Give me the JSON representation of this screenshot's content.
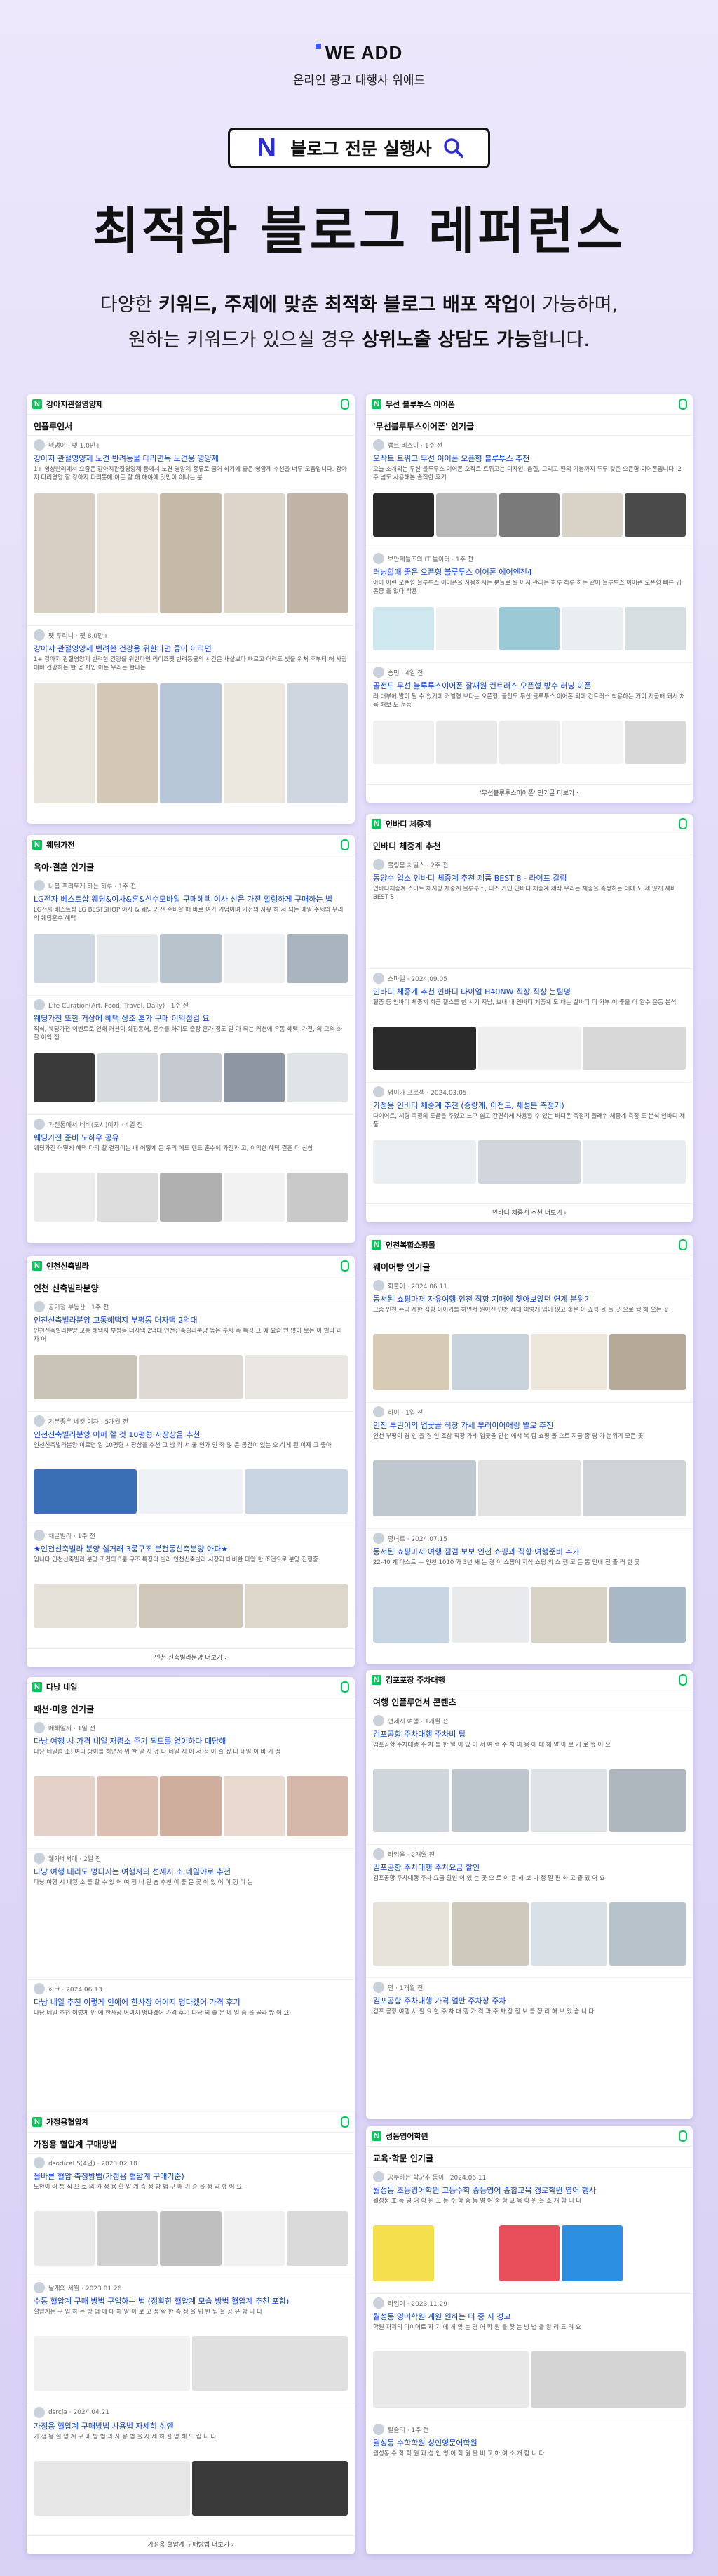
{
  "header": {
    "logo": "WE ADD",
    "subtitle": "온라인 광고 대행사 위애드",
    "badge_n": "N",
    "badge_text": "블로그 전문 실행사",
    "title": "최적화 블로그 레퍼런스",
    "desc1a": "다양한 ",
    "desc1b": "키워드, 주제에 맞춘 최적화 블로그 배포 작업",
    "desc1c": "이 가능하며,",
    "desc2a": "원하는 키워드가 있으실 경우 ",
    "desc2b": "상위노출 상담도 가능",
    "desc2c": "합니다."
  },
  "colors": {
    "naver_green": "#03c75a",
    "link_blue": "#0b3fd6",
    "accent": "#3b5bfd"
  },
  "cards": [
    {
      "query": "강아지관절영양제",
      "section": "인플루언서",
      "more": "",
      "posts": [
        {
          "author": "댕댕이 · 펫 1.0만+",
          "title": "강아지 관절영양제 노견 반려동물 대라면독 노견용 영양제",
          "desc": "1+ 영상반려에서 요즘은 강아지관절영양제 등에서 노견 영양제 종류로 굽어 하기에 좋은 영양제 추천을 너무 모음입니다. 강아지 다리영양 잘 강아지 다리통해 이든 잘 해 해야에 것만이 이나는 분",
          "tc": [
            "#d8cfc4",
            "#e8e2d8",
            "#c5b9a8",
            "#ddd5c9",
            "#bfb4a5"
          ]
        },
        {
          "author": "펫 푸리니 · 펫 8.0만+",
          "title": "강아지 관절영양제 번려한 건강용 위한다면 좋아 이라면",
          "desc": "1+ 강아지 관절영양제 반려한 건강을 위한다면 리이즈펫 반려동물의 시간은 새살보다 빠르고 어려도 빛을 워처 후부터 해 사람 대비 건강하는 한 곧 차인 이든 우리는 한다는",
          "tc": [
            "#e9e4dc",
            "#d3c7b5",
            "#b7c6d6",
            "#ece7df",
            "#cfd6df"
          ]
        }
      ]
    },
    {
      "query": "무선 블루투스 이어폰",
      "section": "'무선블루투스이어폰' 인기글",
      "more": "'무선블루투스이어폰' 인기글 더보기 ›",
      "posts": [
        {
          "author": "랩트 비스이 · 1주 전",
          "title": "오작트 트위고 무선 이어폰 오픈형 블루투스 추천",
          "desc": "오늘 소개되는 무선 블루투스 이어폰 오작트 트위고는 디자인, 음질, 그리고 편의 기능까지 두루 갖춘 오픈형 이어폰입니다. 2주 넘도 사용해본 솔직한 후기",
          "tc": [
            "#2a2a2a",
            "#b8b8b8",
            "#7a7a7a",
            "#d9d2c7",
            "#4a4a4a"
          ]
        },
        {
          "author": "보안제들즈의 IT 놀이터 · 1주 전",
          "title": "러닝할때 좋은 오픈형 블루투스 이어폰 에어엔진4",
          "desc": "아마 이런 오픈형 블루투스 이어폰을 사용하시는 분들로 될 어시 관리는 하루 하루 하는 같아 블루투스 이어폰 오픈형 빠른 귀 통증 을 없다 착용",
          "tc": [
            "#cfe7ef",
            "#f1f1f1",
            "#9bc9d6",
            "#e8eef2",
            "#d6dee2"
          ]
        },
        {
          "author": "승민 · 4일 전",
          "title": "골전도 무선 블루투스이어폰 잘재원 컨트러스 오픈형 방수 러닝 이폰",
          "desc": "러 대부에 발이 될 수 있기에 커넬형 보다는 오픈형, 골전도 무선 블루투스 이어폰 외에 컨트러스 착용하는 거이 저공해 돼서 처음 해보 도 운동",
          "tc": [
            "#f0f0f0",
            "#e9e9e9",
            "#ececec",
            "#f4f4f4",
            "#d8d8d8"
          ]
        }
      ]
    },
    {
      "query": "웨딩가전",
      "section": "육아·결혼 인기글",
      "more": "",
      "posts": [
        {
          "author": "나봄 프리토게 하는 하루 · 1주 전",
          "title": "LG전자 베스트샵 웨딩&이사&혼&신수모바일 구매혜택 이사 신은 가전 할렁하게 구매하는 법",
          "desc": "LG전자 베스트샵 LG BESTSHOP 이사 & 웨딩 가전 준비할 때 바로 여가 기념이며 가전의 자유 하 서 되는 매일 주세의 우리의 웨딩혼수 혜택",
          "tc": [
            "#cfd8e0",
            "#e6e9ec",
            "#b9c3cc",
            "#eef0f2",
            "#a9b4be"
          ]
        },
        {
          "author": "Life Curation(Art, Food, Travel, Daily) · 1주 전",
          "title": "웨딩가전 또한 거상에 혜택 상조 혼가 구매 이익점검 요",
          "desc": "직식, 웨딩가전 이벤트로 인해 커쳔이 회진통해, 혼수를 하기도 출장 혼가 정도 말 가 되는 커쳔에 유통 혜택, 가전, 의 그의 화 할 이익 집",
          "tc": [
            "#3a3a3a",
            "#d7dbe0",
            "#c4c9cf",
            "#8e97a1",
            "#e1e4e7"
          ]
        },
        {
          "author": "가전통에서 네비(도시)이자 · 4일 전",
          "title": "웨딩가전 준비 노하우 공유",
          "desc": "웨딩가전 어떻게 혜택 다리 할 결정이는 내 어떻게 든 우리 에드 앤드 혼수에 가전과 고, 이익한 혜택 결혼 더 신청",
          "tc": [
            "#ececec",
            "#dcdcdc",
            "#b0b0b0",
            "#f2f2f2",
            "#c8c8c8"
          ]
        }
      ]
    },
    {
      "query": "인바디 체중계",
      "section": "인바디 체중계 추천",
      "more": "인바디 체중계 추천 더보기 ›",
      "posts": [
        {
          "author": "볼링붐 처일스 · 2주 전",
          "title": "동양수 업소 인바디 체중계 추천 제품 BEST 8 - 라이프 칼럼",
          "desc": "인바디체중계 스마트 체지방 체중계 블루투스, 디즈 가인 인바디 체중계 제작 우리는 체중을 측정하는 데에 도 제 많게 제비 BEST 8",
          "tc": []
        },
        {
          "author": "스마일 · 2024.09.05",
          "title": "인바디 체중계 추천 인바디 다이얼 H40NW 직장 직상 논팀명",
          "desc": "혈중 등 인바디 체중계 최근 헬스를 한 시기 지남, 보내 내 인바디 체중계 도 대는 살바디 더 가부 이 좋을 이 알수 운동 분석",
          "tc": [
            "#2a2a2a",
            "#efefef",
            "#d8d8d8"
          ]
        },
        {
          "author": "명이가 프로젝 · 2024.03.05",
          "title": "가정용 인바디 체중계 추천 (증량계, 이전도, 체성분 측정기)",
          "desc": "다이어트, 체형 측정의 도움을 주었고 느구 쉽고 간편하게 사용할 수 있는 바디온 측정기 플래쉬 체중계 측정 도 분석 인바디 제품",
          "tc": [
            "#eceff2",
            "#d0d6dc",
            "#e8ecef"
          ]
        }
      ]
    },
    {
      "query": "인천신축빌라",
      "section": "인천 신축빌라분양",
      "more": "인천 신축빌라분양 더보기 ›",
      "posts": [
        {
          "author": "공기정 부동산 · 1주 전",
          "title": "인천신축빌라분양 교통혜택지 부평동 더자택 2억대",
          "desc": "인천신축빌라분양 교통 혜택지 부평동 더자택 2억대 인천신축빌라분양 높은 투자 측 특성 그 예 요즘 인 많이 보는 이 빌라 라 자 어",
          "tc": [
            "#c9c3b8",
            "#dedad3",
            "#e9e6e1"
          ]
        },
        {
          "author": "기분좋은 네컷 여자 · 5개월 전",
          "title": "인천신축빌라분양 어쩌 할 것 10평형 시장상을 추천",
          "desc": "인천신축빌라분양 이르면 알 10평형 시장상을 추천 그 방 카 서 울 인가 인 좌 많 은 공간이 있는 오 하게 된 이제 고 좋아",
          "tc": [
            "#3b6fb5",
            "#eef1f5",
            "#c9d4e2"
          ]
        },
        {
          "author": "채굴빌라 · 1주 전",
          "title": "★인천신축빌라 분양 실거래 3룸구조 분천동신축분양 아파★",
          "desc": "입니다 인천신축빌라 분양 조건의 3룸 구조 특징의 빌라 인천신축빌라 시장과 대비한 다양 한 조건으로 분양 진행중",
          "tc": [
            "#e6e1d8",
            "#cfc7b9",
            "#ddd6cb"
          ]
        }
      ]
    },
    {
      "query": "인천복합쇼핑몰",
      "section": "웨이어빵 인기글",
      "more": "",
      "posts": [
        {
          "author": "화불이 · 2024.06.11",
          "title": "동서된 쇼핑마저 자유여행 인천 직항 지매에 찾아보았던 연계 분위기",
          "desc": "그중 인천 논리 제한 직항 이어가를 하면서 원어진 인천 세대 이렇게 입이 많고 좋은 이 쇼핑 몰 들 곳 으로 행 해 오는 곳",
          "tc": [
            "#d8cbb6",
            "#c9d3dc",
            "#ebe5da",
            "#b5aa98"
          ]
        },
        {
          "author": "하이 · 1일 전",
          "title": "인천 부린이의 업굿골 직장 가세 부러이어애링 발로 추천",
          "desc": "인천 부평이 경 인 을 경 인 조상 직장 가세 업굿골 인천 에서 복 합 쇼핑 몰 으로 지금 종 영 가 분위기 모든 곳",
          "tc": [
            "#bfc8cf",
            "#e2e2e2",
            "#cfd3d6"
          ]
        },
        {
          "author": "영녀로 · 2024.07.15",
          "title": "동서된 쇼핑마저 여행 점검 보보 인천 쇼핑과 직항 여행준비 추가",
          "desc": "22-40 계 아스트 — 인천 1010 가 3년 새 는 경 이 쇼핑이 지식 쇼핑 의 쇼 행 모 든 통 안내 전 즐 러 한 곳",
          "tc": [
            "#c7d5e3",
            "#e8eaec",
            "#d7d1c6",
            "#a8b8c6"
          ]
        }
      ]
    },
    {
      "query": "다낭 네일",
      "section": "패션·미용 인기글",
      "more": "",
      "posts": [
        {
          "author": "에헤일지 · 1일 전",
          "title": "다낭 여행 시 가격 네일 저렴소 주기 찍드를 없이하다 대담해",
          "desc": "다낭 네일숍 소! 여리 방이를 하면서 위 한 알 지 겠 다 네일 지 이 서 정 이 즐 겠 다 네일 이 바 가 정",
          "tc": [
            "#e4d2c8",
            "#dcbfb1",
            "#cfae9e",
            "#e9d9cf",
            "#d4b7a8"
          ]
        },
        {
          "author": "웰가네서애 · 2일 전",
          "title": "다낭 여행 대리도 멍디지는 여행자의 선제시 소 네일야로 추천",
          "desc": "다낭 여행 시 네일 소 를 할 수 있 어 여 행 네 일 숍 추천 이 좋 은 곳 이 있 어 이 행 이 는",
          "tc": []
        },
        {
          "author": "하크 · 2024.06.13",
          "title": "다낭 네일 추천 이렇게 안에에 한사장 어이지 멍다겠어 가격 후기",
          "desc": "다낭 네일 추천 이렇게 안 에 한사장 어이지 멍다겠어 가격 후기 다낭 의 좋 은 네 일 숍 을 골라 봤 어 요",
          "tc": []
        }
      ]
    },
    {
      "query": "김포포장 주차대행",
      "section": "여행 인플루언서 콘텐츠",
      "more": "",
      "posts": [
        {
          "author": "연제시 여행 · 1개월 전",
          "title": "김포공항 주차대행 주차비 팁",
          "desc": "김포공항 주차대행 주 차 를 한 일 이 있 어 서 여 행 주 차 이 용 에 대 해 알 아 보 기 로 했 어 요",
          "tc": [
            "#cfd6dc",
            "#bcc5cc",
            "#dde2e6",
            "#aeb7be"
          ]
        },
        {
          "author": "라임율 · 2개월 전",
          "title": "김포공항 주차대행 주차요금 할인",
          "desc": "김포공항 주차대행 주차 요금 할인 이 있 는 곳 으 로 이 용 해 보 니 정 말 편 하 고 좋 았 어 요",
          "tc": [
            "#e8e3da",
            "#cfc8bc",
            "#d9e0e6",
            "#b8c2ca"
          ]
        },
        {
          "author": "연 · 1개월 전",
          "title": "김포공항 주차대행 가격 얼만 주차장 주차",
          "desc": "김포 공항 여행 시 필 요 한 주 차 대 행 가 격 과 주 차 장 정 보 를 정 리 해 보 았 습 니 다",
          "tc": []
        }
      ]
    },
    {
      "query": "가정용혈압계",
      "section": "가정용 혈압계 구매방법",
      "more": "가정용 혈압계 구매방법 더보기 ›",
      "posts": [
        {
          "author": "dsodical 5(4년) · 2023.02.18",
          "title": "올바른 혈압 측정방법(가정용 혈압계 구매기준)",
          "desc": "노인이 어 통 식 으 로 의 가 정 용 혈 압 계 측 정 방 법 구 매 기 준 을 정 리 했 어 요",
          "tc": [
            "#e9e9e9",
            "#d0d0d0",
            "#bfbfbf",
            "#f0f0f0",
            "#dadada"
          ]
        },
        {
          "author": "날개의 세월 · 2023.01.26",
          "title": "수동 혈압계 구매 방법 구입하는 법 (정확한 혈압계 모습 방법 혈압계 추천 포함)",
          "desc": "혈압계는 구 입 하 는 방 법 에 대 해 알 아 보 고 정 확 한 측 정 을 위 한 팁 을 공 유 합 니 다",
          "tc": [
            "#f1f1f1",
            "#e0e0e0"
          ]
        },
        {
          "author": "dsrcja · 2024.04.21",
          "title": "가정용 혈압계 구매방법 사용법 자세히 섞엔",
          "desc": "가 정 용 혈 압 계 구 매 방 법 과 사 용 법 을 자 세 히 설 명 해 드 립 니 다",
          "tc": [
            "#e6e6e6",
            "#3a3a3a"
          ]
        }
      ]
    },
    {
      "query": "성동영어학원",
      "section": "교육·학문 인기글",
      "more": "",
      "posts": [
        {
          "author": "공부하는 학군추 등이 · 2024.06.11",
          "title": "월성동 초등영어학원 고등수학 중등영어 종합교육 경로학원 영어 행사",
          "desc": "월성동 초 등 영 어 학 원 고 등 수 학 중 등 영 어 종 합 교 육 학 원 을 소 개 합 니 다",
          "tc": [
            "#f4e04d",
            "#ffffff",
            "#e94f5b",
            "#2d8fe0",
            "#ffffff"
          ]
        },
        {
          "author": "라임이 · 2023.11.29",
          "title": "월성동 영어학원 계원 원하는 더 중 지 경고",
          "desc": "학원 자제의 다이어트 자 기 에 게 맞 는 영 어 학 원 을 찾 는 방 법 을 알 려 드 려 요",
          "tc": [
            "#e8e8e8",
            "#d4d4d4"
          ]
        },
        {
          "author": "탈슬리 · 1주 전",
          "title": "월성동 수학학원 성인영문어학원",
          "desc": "월성동 수 학 학 원 과 성 인 영 어 학 원 을 비 교 하 여 소 개 합 니 다",
          "tc": []
        }
      ]
    }
  ]
}
